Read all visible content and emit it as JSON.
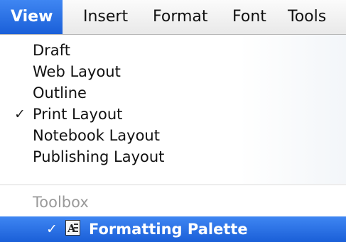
{
  "menubar": {
    "items": [
      {
        "label": "View",
        "active": true
      },
      {
        "label": "Insert"
      },
      {
        "label": "Format"
      },
      {
        "label": "Font"
      },
      {
        "label": "Tools"
      }
    ]
  },
  "view_menu": {
    "items": [
      {
        "label": "Draft",
        "checked": false
      },
      {
        "label": "Web Layout",
        "checked": false
      },
      {
        "label": "Outline",
        "checked": false
      },
      {
        "label": "Print Layout",
        "checked": true
      },
      {
        "label": "Notebook Layout",
        "checked": false
      },
      {
        "label": "Publishing Layout",
        "checked": false
      }
    ],
    "section_header": "Toolbox",
    "highlighted_item": {
      "label": "Formatting Palette",
      "checked": true,
      "icon": "formatting-palette-icon"
    },
    "check_glyph": "✓"
  },
  "colors": {
    "highlight": "#1a5fd8",
    "disabled_text": "#9a9a9a"
  }
}
